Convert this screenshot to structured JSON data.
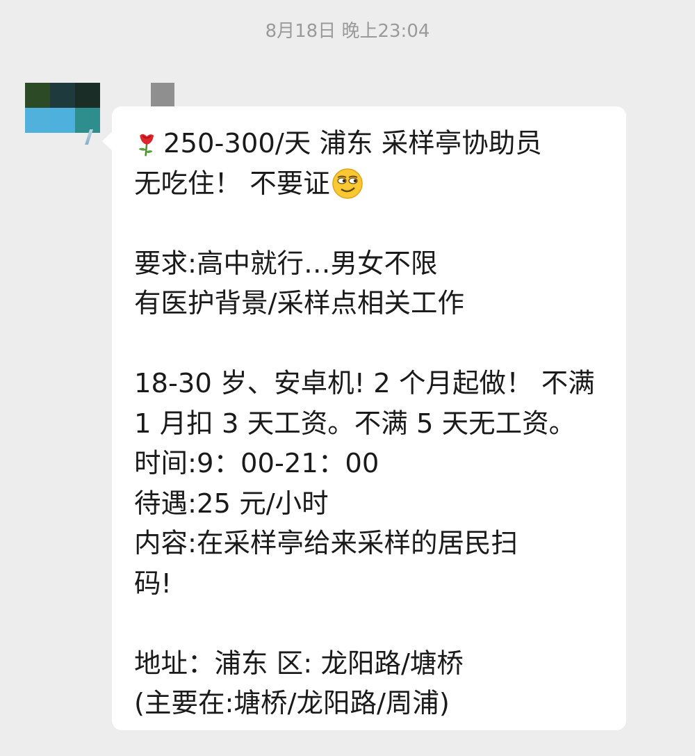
{
  "timestamp": "8月18日 晚上23:04",
  "avatar": {
    "tiles": [
      "#2c4a25",
      "#1f3a3d",
      "#1a2e27",
      "#50b1dc",
      "#4eb0dc",
      "#2e8d8d"
    ]
  },
  "message": {
    "lines": [
      {
        "icon": "rose-emoji",
        "text": "250-300/天 浦东 采样亭协助员"
      },
      {
        "text": "无吃住！ 不要证",
        "icon_after": "smirk-face-emoji"
      },
      {
        "text": ""
      },
      {
        "text": "要求:高中就行…男女不限"
      },
      {
        "text": "有医护背景/采样点相关工作"
      },
      {
        "text": ""
      },
      {
        "text": "18-30 岁、安卓机! 2 个月起做！ 不满"
      },
      {
        "text": "1 月扣 3 天工资。不满 5 天无工资。"
      },
      {
        "text": "时间:9：00-21：00"
      },
      {
        "text": "待遇:25 元/小时"
      },
      {
        "text": "内容:在采样亭给来采样的居民扫"
      },
      {
        "text": "码!"
      },
      {
        "text": ""
      },
      {
        "text": "地址：浦东 区: 龙阳路/塘桥"
      },
      {
        "text": "(主要在:塘桥/龙阳路/周浦)"
      }
    ]
  }
}
